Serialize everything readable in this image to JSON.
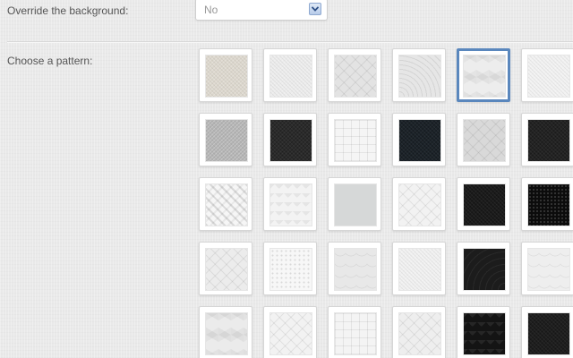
{
  "override": {
    "label": "Override the background:",
    "selected_value": "No"
  },
  "pattern": {
    "label": "Choose a pattern:"
  },
  "colors": {
    "page_bg": "#e9e9e9",
    "selected_border": "#5a87bd"
  },
  "patterns": [
    [
      {
        "bg": "#dcd7cd",
        "tex": "fine",
        "selected": false
      },
      {
        "bg": "#ececec",
        "tex": "fine",
        "selected": false
      },
      {
        "bg": "#e3e3e3",
        "tex": "diag",
        "selected": false
      },
      {
        "bg": "#e6e6e6",
        "tex": "waves",
        "selected": false
      },
      {
        "bg": "#ededed",
        "tex": "cubes",
        "selected": true
      },
      {
        "bg": "#f1f1f1",
        "tex": "fine",
        "selected": false
      }
    ],
    [
      {
        "bg": "#b4b4b4",
        "tex": "fine",
        "selected": false
      },
      {
        "bg": "#2b2b2b",
        "tex": "fine-dark",
        "selected": false
      },
      {
        "bg": "#f5f5f5",
        "tex": "grid",
        "selected": false
      },
      {
        "bg": "#1c2329",
        "tex": "fine-dark",
        "selected": false
      },
      {
        "bg": "#d9d9d9",
        "tex": "diag",
        "selected": false
      },
      {
        "bg": "#232323",
        "tex": "fine-dark",
        "selected": false
      }
    ],
    [
      {
        "bg": "#f6f6f6",
        "tex": "weave",
        "selected": false
      },
      {
        "bg": "#f3f3f3",
        "tex": "zigzag",
        "selected": false
      },
      {
        "bg": "#d6d8d8",
        "tex": "plain",
        "selected": false
      },
      {
        "bg": "#f2f2f2",
        "tex": "diag",
        "selected": false
      },
      {
        "bg": "#1b1b1b",
        "tex": "fine-dark",
        "selected": false
      },
      {
        "bg": "#0c0c0c",
        "tex": "dots-dark",
        "selected": false
      }
    ],
    [
      {
        "bg": "#ececec",
        "tex": "diag",
        "selected": false
      },
      {
        "bg": "#f7f7f7",
        "tex": "dots",
        "selected": false
      },
      {
        "bg": "#e8e8e8",
        "tex": "scales",
        "selected": false
      },
      {
        "bg": "#f0f0f0",
        "tex": "fine",
        "selected": false
      },
      {
        "bg": "#1c1c1c",
        "tex": "waves-dark",
        "selected": false
      },
      {
        "bg": "#eeeeee",
        "tex": "scales",
        "selected": false
      }
    ],
    [
      {
        "bg": "#ebebeb",
        "tex": "cubes",
        "selected": false
      },
      {
        "bg": "#f2f2f2",
        "tex": "diag",
        "selected": false
      },
      {
        "bg": "#f4f4f4",
        "tex": "grid",
        "selected": false
      },
      {
        "bg": "#eeeeee",
        "tex": "diag",
        "selected": false
      },
      {
        "bg": "#141414",
        "tex": "zigzag-dark",
        "selected": false
      },
      {
        "bg": "#1e1e1e",
        "tex": "fine-dark",
        "selected": false
      }
    ]
  ]
}
